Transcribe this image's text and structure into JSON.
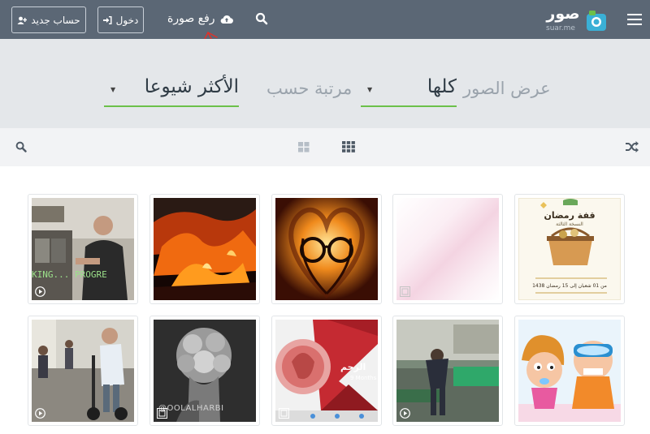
{
  "navbar": {
    "register_label": "حساب جديد",
    "login_label": "دخول",
    "upload_label": "رفع صورة",
    "logo_text": "صور",
    "logo_sub": "suar.me",
    "colors": {
      "bar": "#5b6775",
      "accent_logo": "#3ab0d6",
      "accent_logo_green": "#6cc04a"
    }
  },
  "filters": {
    "display_label": "عرض الصور",
    "display_value": "كلها",
    "sort_label": "مرتبة حسب",
    "sort_value": "الأكثر شيوعا",
    "underline_color": "#6cc04a"
  },
  "toolbar": {
    "left": "search-icon",
    "center": [
      "large-grid-icon",
      "small-grid-icon"
    ],
    "right": "shuffle-icon"
  },
  "gallery": {
    "items": [
      {
        "name": "ramadan-flyer",
        "caption": "قفة رمضان",
        "sub": "النسخة الثالثة",
        "date_line": "من 01 شعبان إلى 15 رمضان 1438",
        "badge": "none"
      },
      {
        "name": "pink-blur",
        "badge": "gallery-icon"
      },
      {
        "name": "heart-book-glasses",
        "badge": "none"
      },
      {
        "name": "fire-smoke",
        "badge": "none"
      },
      {
        "name": "store-worker",
        "overlay_text": "KING... PROGRE",
        "badge": "play-icon"
      },
      {
        "name": "cartoon-kids",
        "badge": "none"
      },
      {
        "name": "man-bending",
        "badge": "play-icon"
      },
      {
        "name": "embryo-slide",
        "overlay_text": "الرحم",
        "sub": "9 Months",
        "badge": "gallery-icon"
      },
      {
        "name": "flower-head-sketch",
        "overlay_text": "@OOLALHARBI",
        "badge": "gallery-icon"
      },
      {
        "name": "segway-rider",
        "badge": "play-icon"
      }
    ]
  }
}
